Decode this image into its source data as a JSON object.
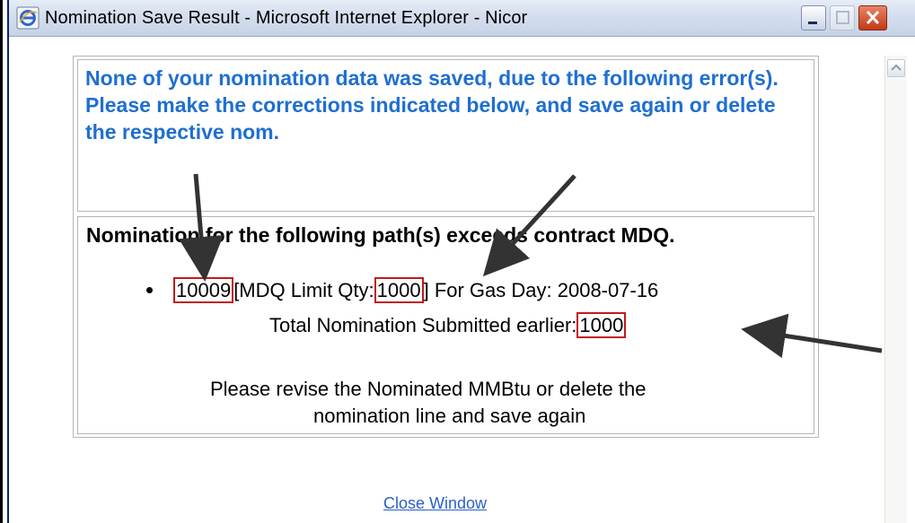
{
  "window": {
    "title": "Nomination Save Result - Microsoft Internet Explorer - Nicor"
  },
  "message": {
    "text": "None of your nomination data was saved, due to the following error(s). Please make the corrections indicated below, and save again or delete the respective nom."
  },
  "error": {
    "heading": "Nomination for the following path(s) exceeds contract MDQ.",
    "path_id": "10009",
    "mdq_prefix": "[MDQ Limit Qty:",
    "mdq_value": "1000",
    "mdq_suffix": "] For Gas Day: 2008-07-16",
    "submitted_label": "Total Nomination Submitted earlier:",
    "submitted_value": "1000",
    "revise_line1": "Please revise the Nominated MMBtu or delete the",
    "revise_line2": "nomination line and save again"
  },
  "links": {
    "close_window": "Close Window"
  },
  "colors": {
    "message_blue": "#1f6fd0",
    "highlight_red": "#c21a1a",
    "link_blue": "#2a5fc9"
  }
}
